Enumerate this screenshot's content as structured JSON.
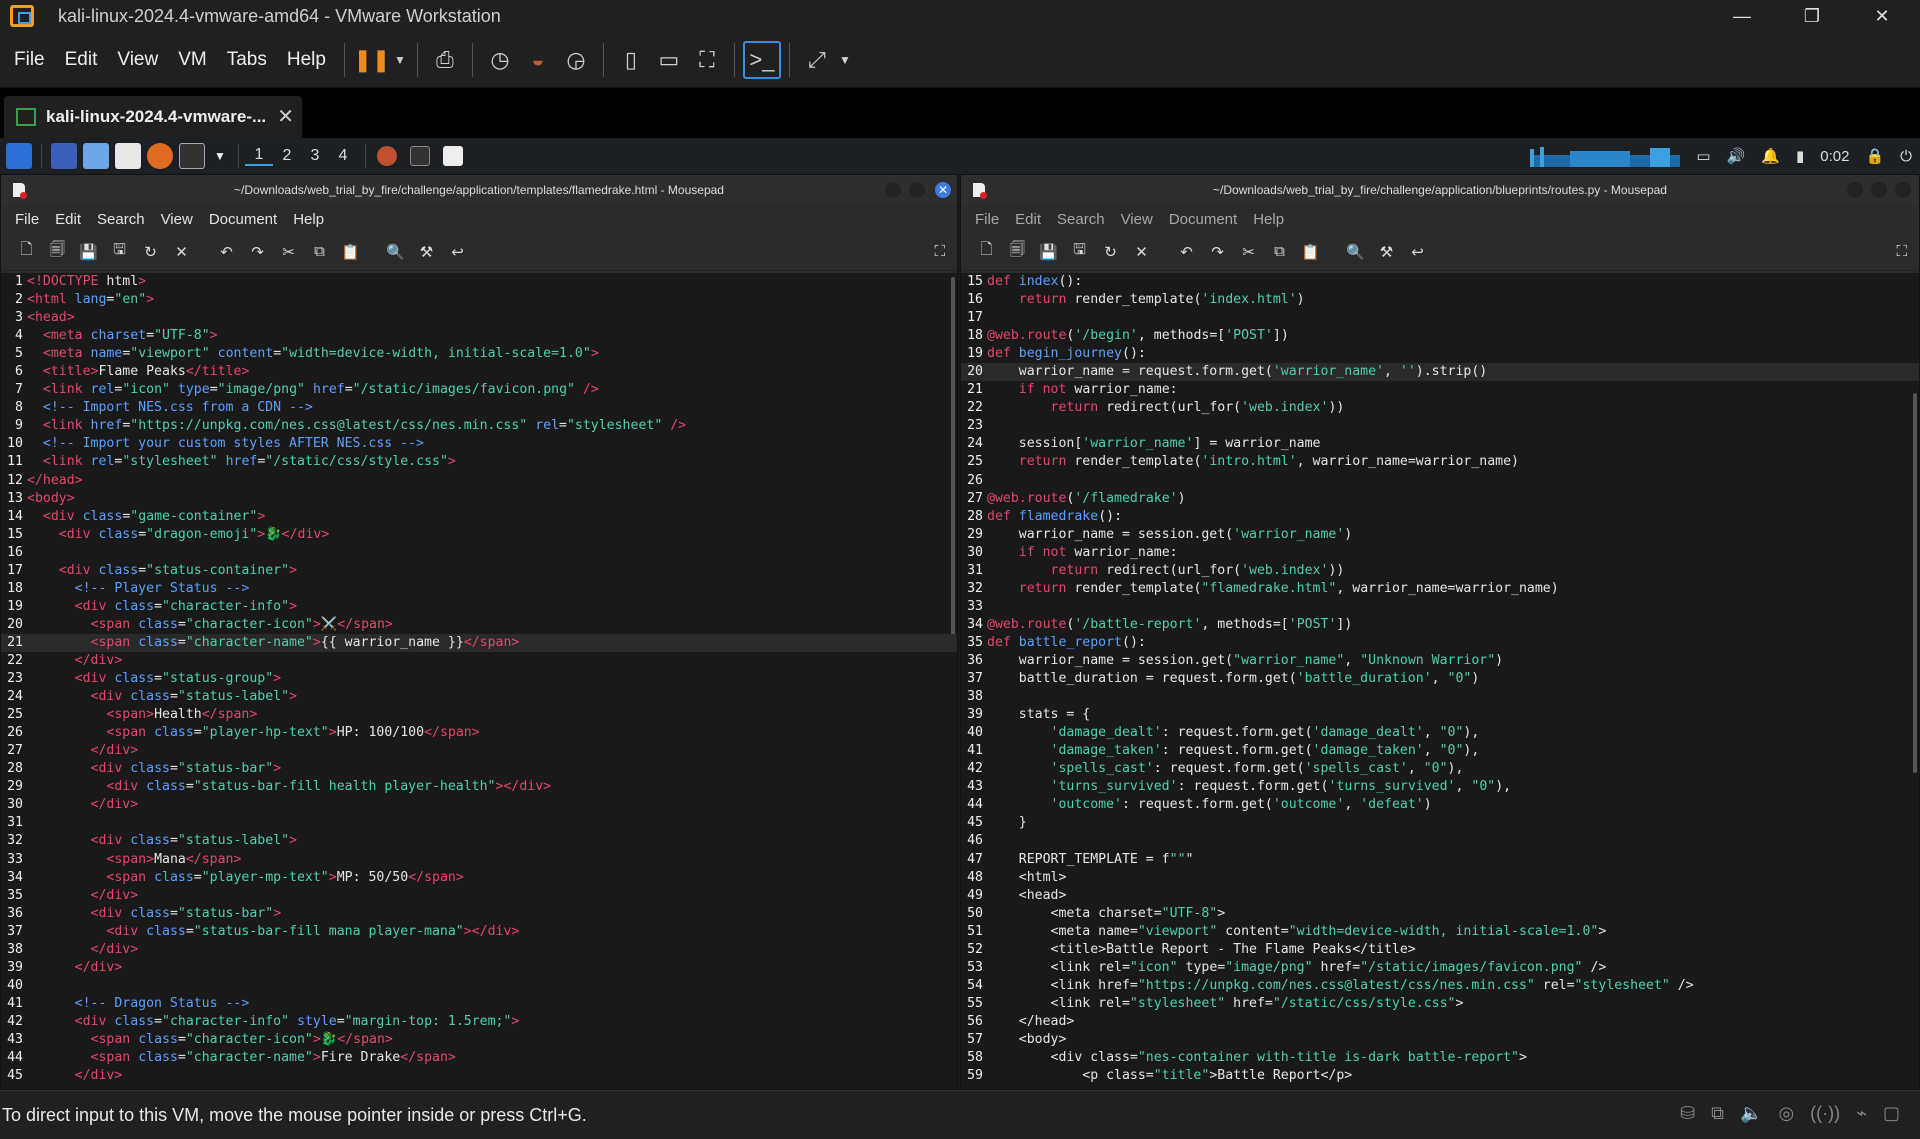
{
  "vmware": {
    "title": "kali-linux-2024.4-vmware-amd64 - VMware Workstation",
    "menu": [
      "File",
      "Edit",
      "View",
      "VM",
      "Tabs",
      "Help"
    ],
    "tab_label": "kali-linux-2024.4-vmware-...",
    "status_text": "To direct input to this VM, move the mouse pointer inside or press Ctrl+G."
  },
  "kali_panel": {
    "workspaces": [
      "1",
      "2",
      "3",
      "4"
    ],
    "clock": "0:02"
  },
  "left_window": {
    "title": "~/Downloads/web_trial_by_fire/challenge/application/templates/flamedrake.html - Mousepad",
    "menu": [
      "File",
      "Edit",
      "Search",
      "View",
      "Document",
      "Help"
    ],
    "current_line": 21,
    "lines": [
      {
        "n": "1",
        "text": "<!DOCTYPE html>"
      },
      {
        "n": "2",
        "text": "<html lang=\"en\">"
      },
      {
        "n": "3",
        "text": "<head>"
      },
      {
        "n": "4",
        "text": "  <meta charset=\"UTF-8\">"
      },
      {
        "n": "5",
        "text": "  <meta name=\"viewport\" content=\"width=device-width, initial-scale=1.0\">"
      },
      {
        "n": "6",
        "text": "  <title>Flame Peaks</title>"
      },
      {
        "n": "7",
        "text": "  <link rel=\"icon\" type=\"image/png\" href=\"/static/images/favicon.png\" />"
      },
      {
        "n": "8",
        "text": "  <!-- Import NES.css from a CDN -->"
      },
      {
        "n": "9",
        "text": "  <link href=\"https://unpkg.com/nes.css@latest/css/nes.min.css\" rel=\"stylesheet\" />"
      },
      {
        "n": "10",
        "text": "  <!-- Import your custom styles AFTER NES.css -->"
      },
      {
        "n": "11",
        "text": "  <link rel=\"stylesheet\" href=\"/static/css/style.css\">"
      },
      {
        "n": "12",
        "text": "</head>"
      },
      {
        "n": "13",
        "text": "<body>"
      },
      {
        "n": "14",
        "text": "  <div class=\"game-container\">"
      },
      {
        "n": "15",
        "text": "    <div class=\"dragon-emoji\">🐉</div>"
      },
      {
        "n": "16",
        "text": ""
      },
      {
        "n": "17",
        "text": "    <div class=\"status-container\">"
      },
      {
        "n": "18",
        "text": "      <!-- Player Status -->"
      },
      {
        "n": "19",
        "text": "      <div class=\"character-info\">"
      },
      {
        "n": "20",
        "text": "        <span class=\"character-icon\">⚔️</span>"
      },
      {
        "n": "21",
        "text": "        <span class=\"character-name\">{{ warrior_name }}</span>"
      },
      {
        "n": "22",
        "text": "      </div>"
      },
      {
        "n": "23",
        "text": "      <div class=\"status-group\">"
      },
      {
        "n": "24",
        "text": "        <div class=\"status-label\">"
      },
      {
        "n": "25",
        "text": "          <span>Health</span>"
      },
      {
        "n": "26",
        "text": "          <span class=\"player-hp-text\">HP: 100/100</span>"
      },
      {
        "n": "27",
        "text": "        </div>"
      },
      {
        "n": "28",
        "text": "        <div class=\"status-bar\">"
      },
      {
        "n": "29",
        "text": "          <div class=\"status-bar-fill health player-health\"></div>"
      },
      {
        "n": "30",
        "text": "        </div>"
      },
      {
        "n": "31",
        "text": ""
      },
      {
        "n": "32",
        "text": "        <div class=\"status-label\">"
      },
      {
        "n": "33",
        "text": "          <span>Mana</span>"
      },
      {
        "n": "34",
        "text": "          <span class=\"player-mp-text\">MP: 50/50</span>"
      },
      {
        "n": "35",
        "text": "        </div>"
      },
      {
        "n": "36",
        "text": "        <div class=\"status-bar\">"
      },
      {
        "n": "37",
        "text": "          <div class=\"status-bar-fill mana player-mana\"></div>"
      },
      {
        "n": "38",
        "text": "        </div>"
      },
      {
        "n": "39",
        "text": "      </div>"
      },
      {
        "n": "40",
        "text": ""
      },
      {
        "n": "41",
        "text": "      <!-- Dragon Status -->"
      },
      {
        "n": "42",
        "text": "      <div class=\"character-info\" style=\"margin-top: 1.5rem;\">"
      },
      {
        "n": "43",
        "text": "        <span class=\"character-icon\">🐉</span>"
      },
      {
        "n": "44",
        "text": "        <span class=\"character-name\">Fire Drake</span>"
      },
      {
        "n": "45",
        "text": "      </div>"
      }
    ]
  },
  "right_window": {
    "title": "~/Downloads/web_trial_by_fire/challenge/application/blueprints/routes.py - Mousepad",
    "menu": [
      "File",
      "Edit",
      "Search",
      "View",
      "Document",
      "Help"
    ],
    "current_line": 20,
    "lines": [
      {
        "n": "15",
        "text": "def index():"
      },
      {
        "n": "16",
        "text": "    return render_template('index.html')"
      },
      {
        "n": "17",
        "text": ""
      },
      {
        "n": "18",
        "text": "@web.route('/begin', methods=['POST'])"
      },
      {
        "n": "19",
        "text": "def begin_journey():"
      },
      {
        "n": "20",
        "text": "    warrior_name = request.form.get('warrior_name', '').strip()"
      },
      {
        "n": "21",
        "text": "    if not warrior_name:"
      },
      {
        "n": "22",
        "text": "        return redirect(url_for('web.index'))"
      },
      {
        "n": "23",
        "text": ""
      },
      {
        "n": "24",
        "text": "    session['warrior_name'] = warrior_name"
      },
      {
        "n": "25",
        "text": "    return render_template('intro.html', warrior_name=warrior_name)"
      },
      {
        "n": "26",
        "text": ""
      },
      {
        "n": "27",
        "text": "@web.route('/flamedrake')"
      },
      {
        "n": "28",
        "text": "def flamedrake():"
      },
      {
        "n": "29",
        "text": "    warrior_name = session.get('warrior_name')"
      },
      {
        "n": "30",
        "text": "    if not warrior_name:"
      },
      {
        "n": "31",
        "text": "        return redirect(url_for('web.index'))"
      },
      {
        "n": "32",
        "text": "    return render_template(\"flamedrake.html\", warrior_name=warrior_name)"
      },
      {
        "n": "33",
        "text": ""
      },
      {
        "n": "34",
        "text": "@web.route('/battle-report', methods=['POST'])"
      },
      {
        "n": "35",
        "text": "def battle_report():"
      },
      {
        "n": "36",
        "text": "    warrior_name = session.get(\"warrior_name\", \"Unknown Warrior\")"
      },
      {
        "n": "37",
        "text": "    battle_duration = request.form.get('battle_duration', \"0\")"
      },
      {
        "n": "38",
        "text": ""
      },
      {
        "n": "39",
        "text": "    stats = {"
      },
      {
        "n": "40",
        "text": "        'damage_dealt': request.form.get('damage_dealt', \"0\"),"
      },
      {
        "n": "41",
        "text": "        'damage_taken': request.form.get('damage_taken', \"0\"),"
      },
      {
        "n": "42",
        "text": "        'spells_cast': request.form.get('spells_cast', \"0\"),"
      },
      {
        "n": "43",
        "text": "        'turns_survived': request.form.get('turns_survived', \"0\"),"
      },
      {
        "n": "44",
        "text": "        'outcome': request.form.get('outcome', 'defeat')"
      },
      {
        "n": "45",
        "text": "    }"
      },
      {
        "n": "46",
        "text": ""
      },
      {
        "n": "47",
        "text": "    REPORT_TEMPLATE = f\"\"\""
      },
      {
        "n": "48",
        "text": "    <html>"
      },
      {
        "n": "49",
        "text": "    <head>"
      },
      {
        "n": "50",
        "text": "        <meta charset=\"UTF-8\">"
      },
      {
        "n": "51",
        "text": "        <meta name=\"viewport\" content=\"width=device-width, initial-scale=1.0\">"
      },
      {
        "n": "52",
        "text": "        <title>Battle Report - The Flame Peaks</title>"
      },
      {
        "n": "53",
        "text": "        <link rel=\"icon\" type=\"image/png\" href=\"/static/images/favicon.png\" />"
      },
      {
        "n": "54",
        "text": "        <link href=\"https://unpkg.com/nes.css@latest/css/nes.min.css\" rel=\"stylesheet\" />"
      },
      {
        "n": "55",
        "text": "        <link rel=\"stylesheet\" href=\"/static/css/style.css\">"
      },
      {
        "n": "56",
        "text": "    </head>"
      },
      {
        "n": "57",
        "text": "    <body>"
      },
      {
        "n": "58",
        "text": "        <div class=\"nes-container with-title is-dark battle-report\">"
      },
      {
        "n": "59",
        "text": "            <p class=\"title\">Battle Report</p>"
      }
    ]
  },
  "colors": {
    "tag": "#e8456b",
    "attr": "#5aa0ff",
    "string": "#4cd0b0",
    "keyword": "#e8456b",
    "func": "#5aa0ff",
    "comment": "#5aa0ff",
    "text": "#e6e6e6"
  }
}
